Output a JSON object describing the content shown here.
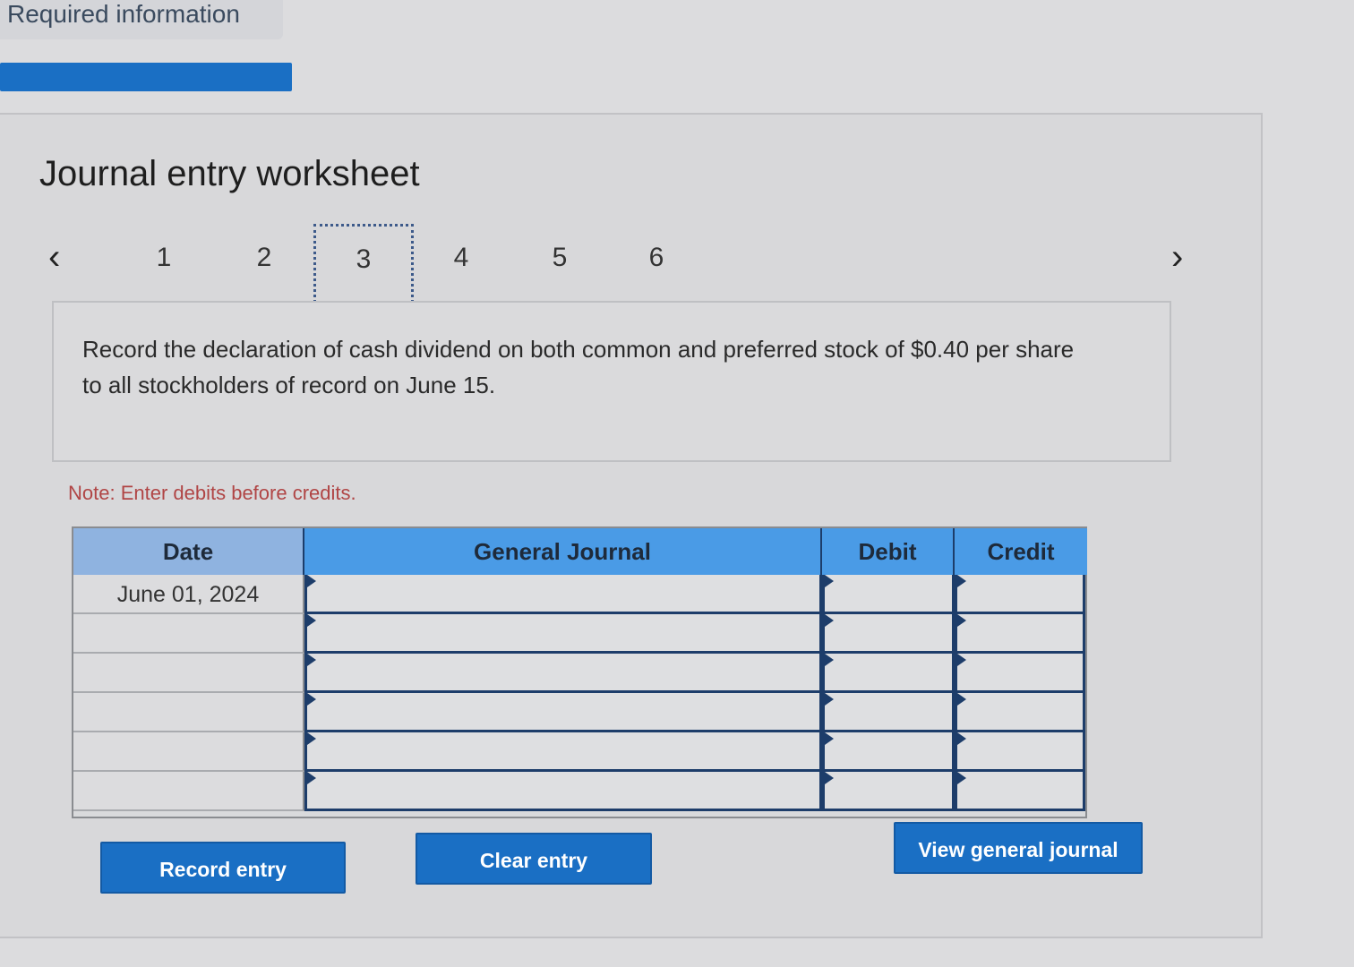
{
  "header": {
    "required_label": "Required information"
  },
  "worksheet": {
    "title": "Journal entry worksheet",
    "prev_icon": "chevron-left-icon",
    "next_icon": "chevron-right-icon",
    "steps": [
      "1",
      "2",
      "3",
      "4",
      "5",
      "6"
    ],
    "active_step": "3",
    "prompt": "Record the declaration of cash dividend on both common and preferred stock of $0.40 per share to all stockholders of record on June 15.",
    "note": "Note: Enter debits before credits."
  },
  "journal": {
    "columns": {
      "date": "Date",
      "general_journal": "General Journal",
      "debit": "Debit",
      "credit": "Credit"
    },
    "rows": [
      {
        "date": "June 01, 2024",
        "account": "",
        "debit": "",
        "credit": ""
      },
      {
        "date": "",
        "account": "",
        "debit": "",
        "credit": ""
      },
      {
        "date": "",
        "account": "",
        "debit": "",
        "credit": ""
      },
      {
        "date": "",
        "account": "",
        "debit": "",
        "credit": ""
      },
      {
        "date": "",
        "account": "",
        "debit": "",
        "credit": ""
      },
      {
        "date": "",
        "account": "",
        "debit": "",
        "credit": ""
      }
    ]
  },
  "buttons": {
    "record": "Record entry",
    "clear": "Clear entry",
    "view": "View general journal"
  },
  "colors": {
    "accent": "#1a6fc4",
    "header_light": "#8fb3e0",
    "header_blue": "#4a9be6",
    "note_red": "#b04545"
  }
}
